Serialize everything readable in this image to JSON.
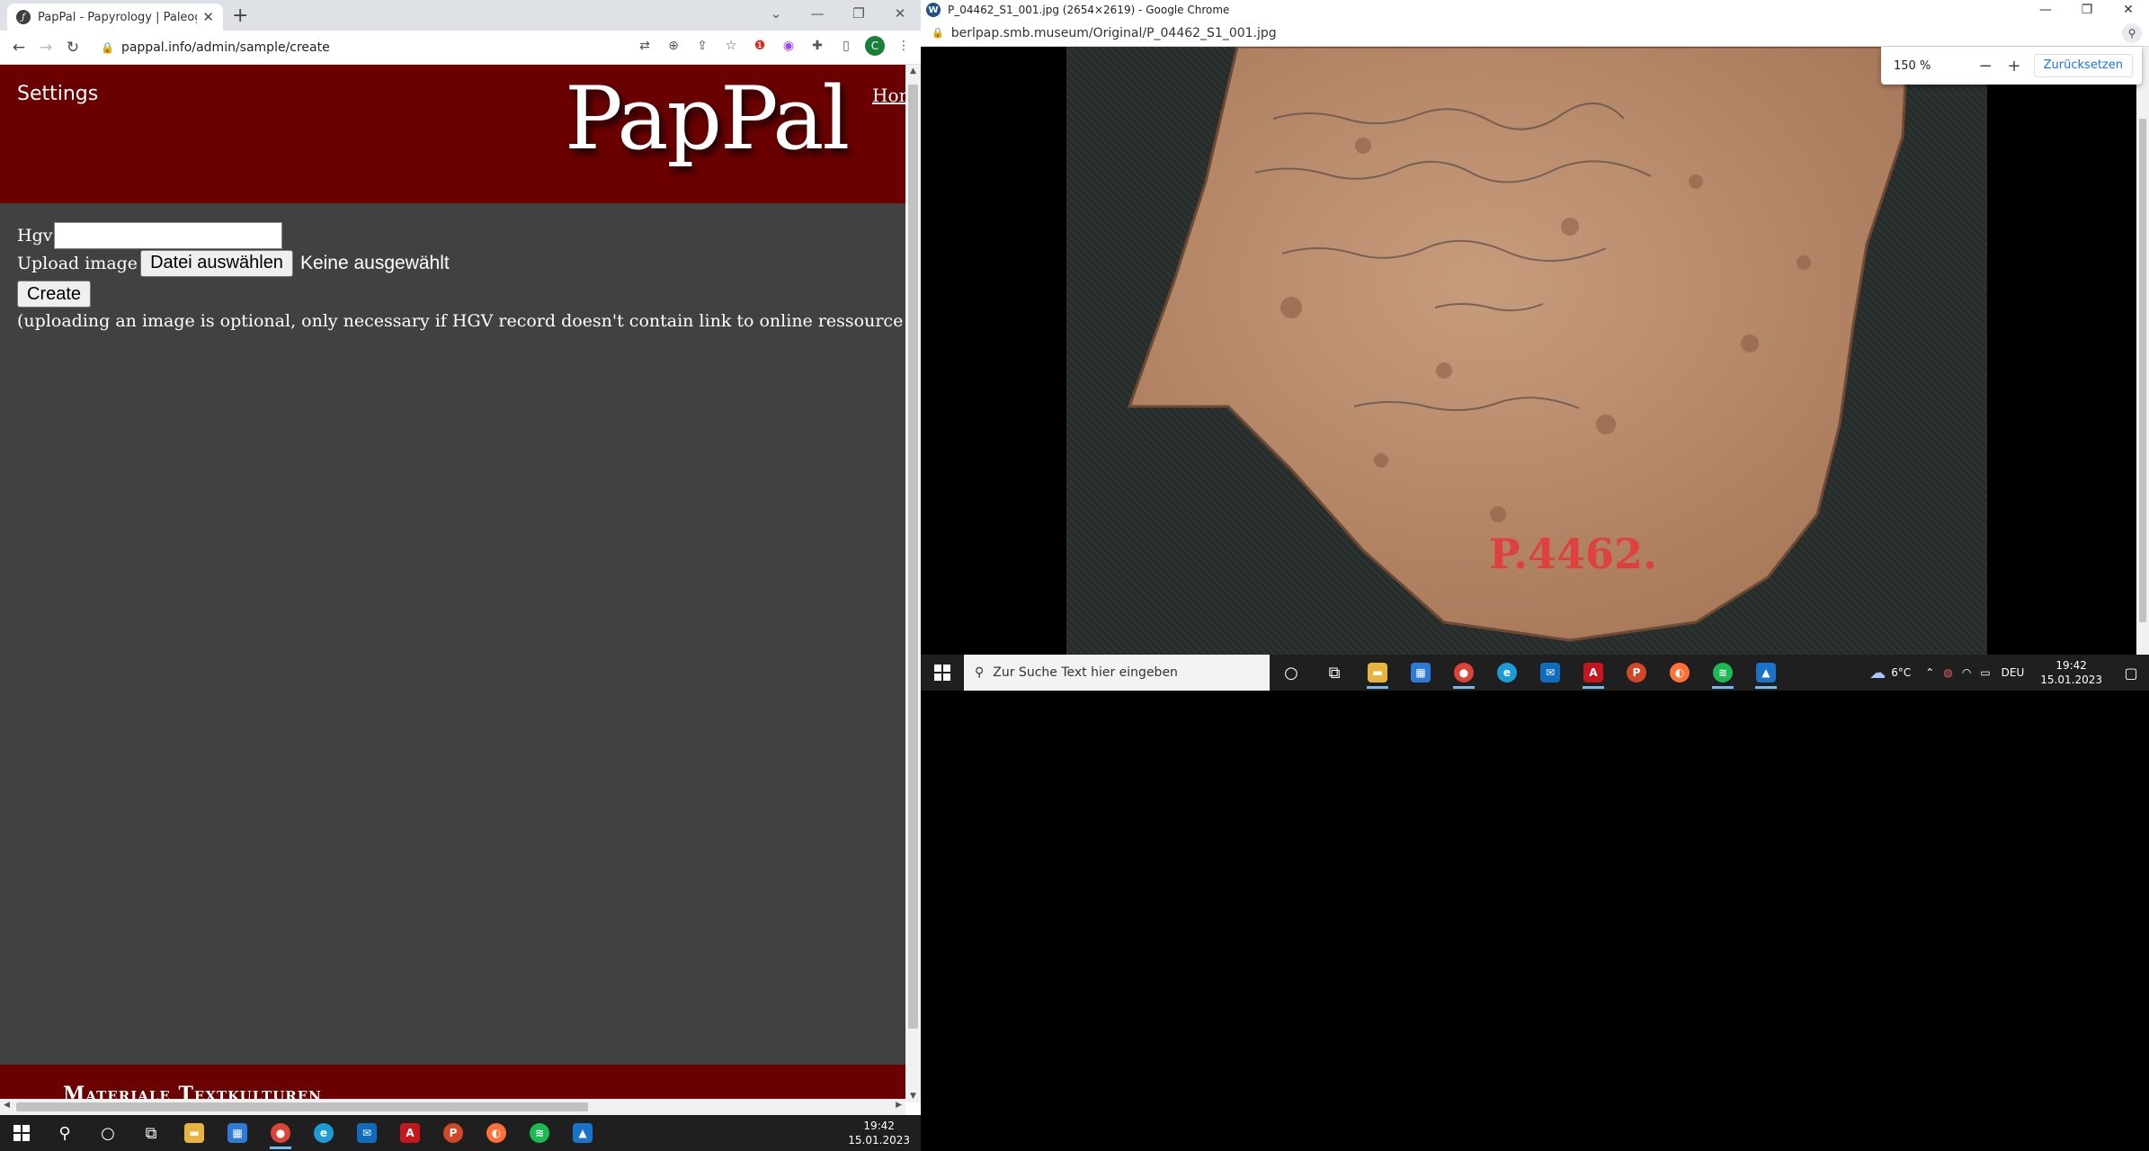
{
  "left_browser": {
    "tab_title": "PapPal - Papyrology | Paleograph",
    "url": "pappal.info/admin/sample/create",
    "profile_initial": "C",
    "page": {
      "settings_label": "Settings",
      "logo_text": "PapPal",
      "home_label": "Hom",
      "form": {
        "hgv_label": "Hgv",
        "upload_label": "Upload image",
        "file_button_label": "Datei auswählen",
        "file_status": "Keine ausgewählt",
        "create_label": "Create",
        "note": "(uploading an image is optional, only necessary if HGV record doesn't contain link to online ressource or if online arc"
      },
      "footer_title": "Materiale Textkulturen"
    }
  },
  "right_browser": {
    "window_title": "P_04462_S1_001.jpg (2654×2619) - Google Chrome",
    "url": "berlpap.smb.museum/Original/P_04462_S1_001.jpg",
    "zoom_level": "150 %",
    "zoom_minus": "−",
    "zoom_plus": "+",
    "reset_label": "Zurücksetzen",
    "sherd_label": "P.4462."
  },
  "taskbar_right": {
    "search_placeholder": "Zur Suche Text hier eingeben",
    "weather": "6°C",
    "language": "DEU",
    "time": "19:42",
    "date": "15.01.2023"
  },
  "taskbar_left": {
    "time": "19:42",
    "date": "15.01.2023"
  },
  "colors": {
    "site_header": "#6b0000",
    "page_bg": "#414141",
    "taskbar": "#1f1f1f"
  }
}
